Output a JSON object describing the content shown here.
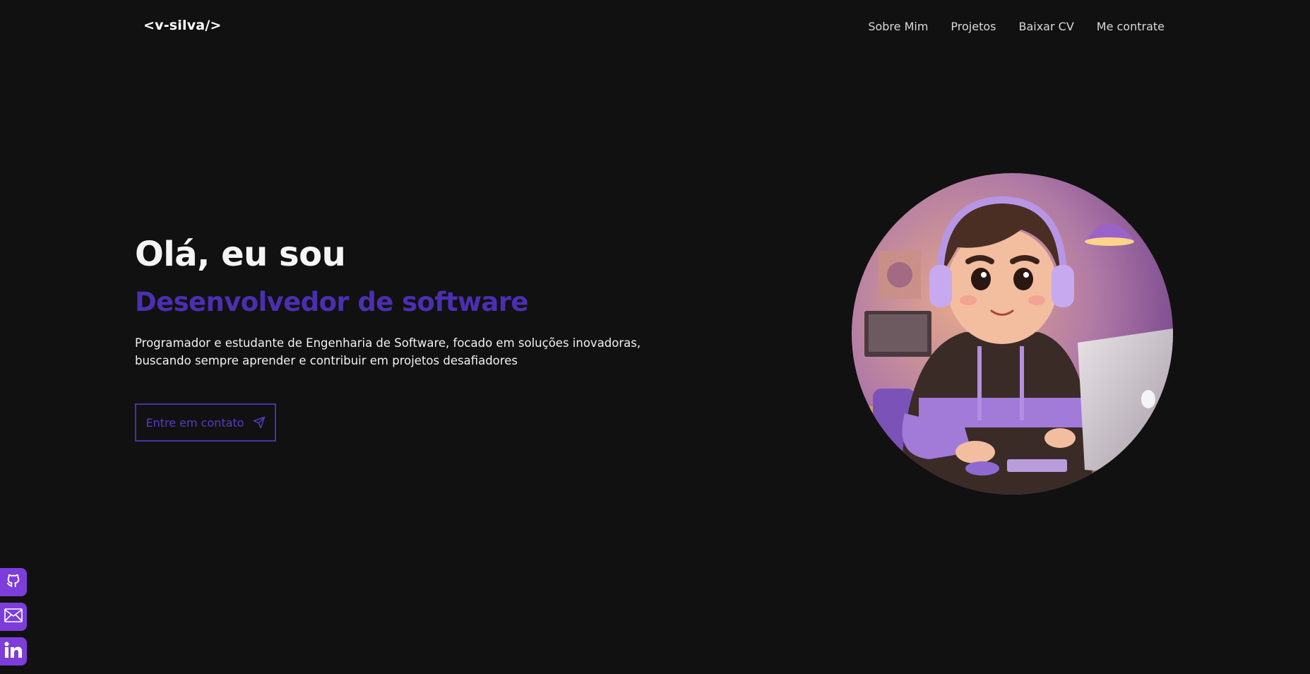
{
  "header": {
    "logo": "<v-silva/>",
    "nav": [
      {
        "label": "Sobre Mim"
      },
      {
        "label": "Projetos"
      },
      {
        "label": "Baixar CV"
      },
      {
        "label": "Me contrate"
      }
    ]
  },
  "hero": {
    "greeting": "Olá, eu sou",
    "role": "Desenvolvedor de software",
    "description_line1": "Programador e estudante de Engenharia de Software, focado em soluções inovadoras,",
    "description_line2": "buscando sempre aprender e contribuir em projetos desafiadores",
    "cta_label": "Entre em contato",
    "cta_icon": "send-icon"
  },
  "avatar": {
    "icon": "developer-avatar-illustration"
  },
  "social": [
    {
      "icon": "github-icon"
    },
    {
      "icon": "mail-icon"
    },
    {
      "icon": "linkedin-icon"
    }
  ],
  "colors": {
    "background": "#111111",
    "accent": "#4b2fb0",
    "social_bg": "#7c3ddb",
    "text": "#f2f2f2"
  }
}
